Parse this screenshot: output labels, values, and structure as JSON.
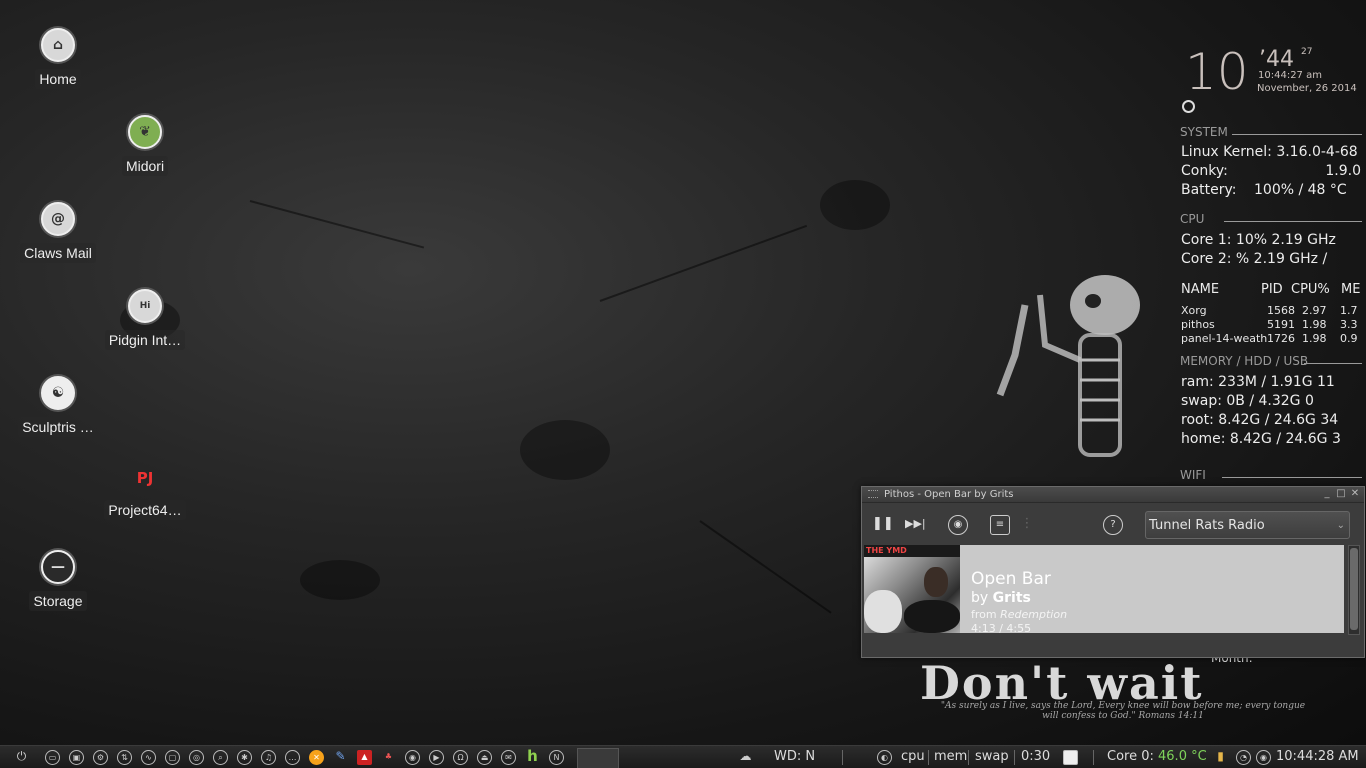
{
  "desktop": {
    "icons": [
      {
        "label": "Home",
        "icon": "home-icon"
      },
      {
        "label": "Midori",
        "icon": "midori-icon"
      },
      {
        "label": "Claws Mail",
        "icon": "claws-mail-icon"
      },
      {
        "label": "Pidgin Int…",
        "icon": "pidgin-icon"
      },
      {
        "label": "Sculptris …",
        "icon": "sculptris-icon"
      },
      {
        "label": "Project64…",
        "icon": "project64-icon"
      },
      {
        "label": "Storage",
        "icon": "storage-icon"
      }
    ]
  },
  "conky": {
    "clock": {
      "hour": "10",
      "minute": "44",
      "second": "27",
      "time": "10:44:27 am",
      "date": "November, 26 2014"
    },
    "system": {
      "heading": "SYSTEM",
      "kernel_label": "Linux Kernel:",
      "kernel_value": "3.16.0-4-68",
      "conky_label": "Conky:",
      "conky_value": "1.9.0",
      "battery_label": "Battery:",
      "battery_value": "100% / 48 °C"
    },
    "cpu": {
      "heading": "CPU",
      "core1": "Core 1:  10%  2.19 GHz",
      "core2": "Core 2:  %   2.19 GHz /"
    },
    "procs": {
      "headers": [
        "NAME",
        "PID",
        "CPU%",
        "ME"
      ],
      "rows": [
        [
          "Xorg",
          "1568",
          "2.97",
          "1.7"
        ],
        [
          "pithos",
          "5191",
          "1.98",
          "3.3"
        ],
        [
          "panel-14-weath",
          "1726",
          "1.98",
          "0.9"
        ]
      ]
    },
    "memory": {
      "heading": "MEMORY / HDD / USB",
      "ram": "ram: 233M   / 1.91G  11",
      "swap": "swap: 0B     / 4.32G  0",
      "root": "root: 8.42G / 24.6G  34",
      "home": "home: 8.42G / 24.6G  3"
    },
    "wifi_heading": "WIFI"
  },
  "pithos": {
    "title": "Pithos - Open Bar by Grits",
    "station": "Tunnel Rats Radio",
    "song": {
      "title": "Open Bar",
      "by": "by",
      "artist": "Grits",
      "from": "from",
      "album": "Redemption",
      "progress": "4:13 / 4:55"
    },
    "art_band": "THE YMD"
  },
  "wallpaper": {
    "headline": "Don't wait",
    "month": "Month:",
    "verse": "\"As surely as I live, says the Lord, Every knee will bow before me; every tongue will confess to God.\" Romans 14:11"
  },
  "taskbar": {
    "weather": "WD: N",
    "cpu": "cpu",
    "mem": "mem",
    "swap": "swap",
    "uptime": "0:30",
    "core_label": "Core 0:",
    "core_temp": "46.0 °C",
    "clock": "10:44:28 AM",
    "core_temp_color": "#7fd35a",
    "accent": "#8fd14f"
  }
}
